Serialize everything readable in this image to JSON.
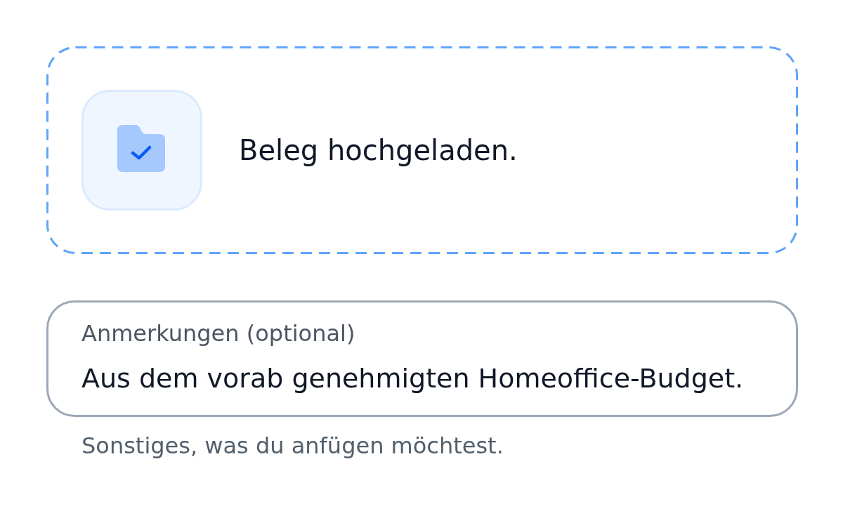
{
  "upload": {
    "uploaded": true,
    "message": "Beleg hochgeladen."
  },
  "notes_field": {
    "label": "Anmerkungen (optional)",
    "value": "Aus dem vorab genehmigten Homeoffice-Budget.",
    "helper": "Sonstiges, was du anfügen möchtest."
  }
}
